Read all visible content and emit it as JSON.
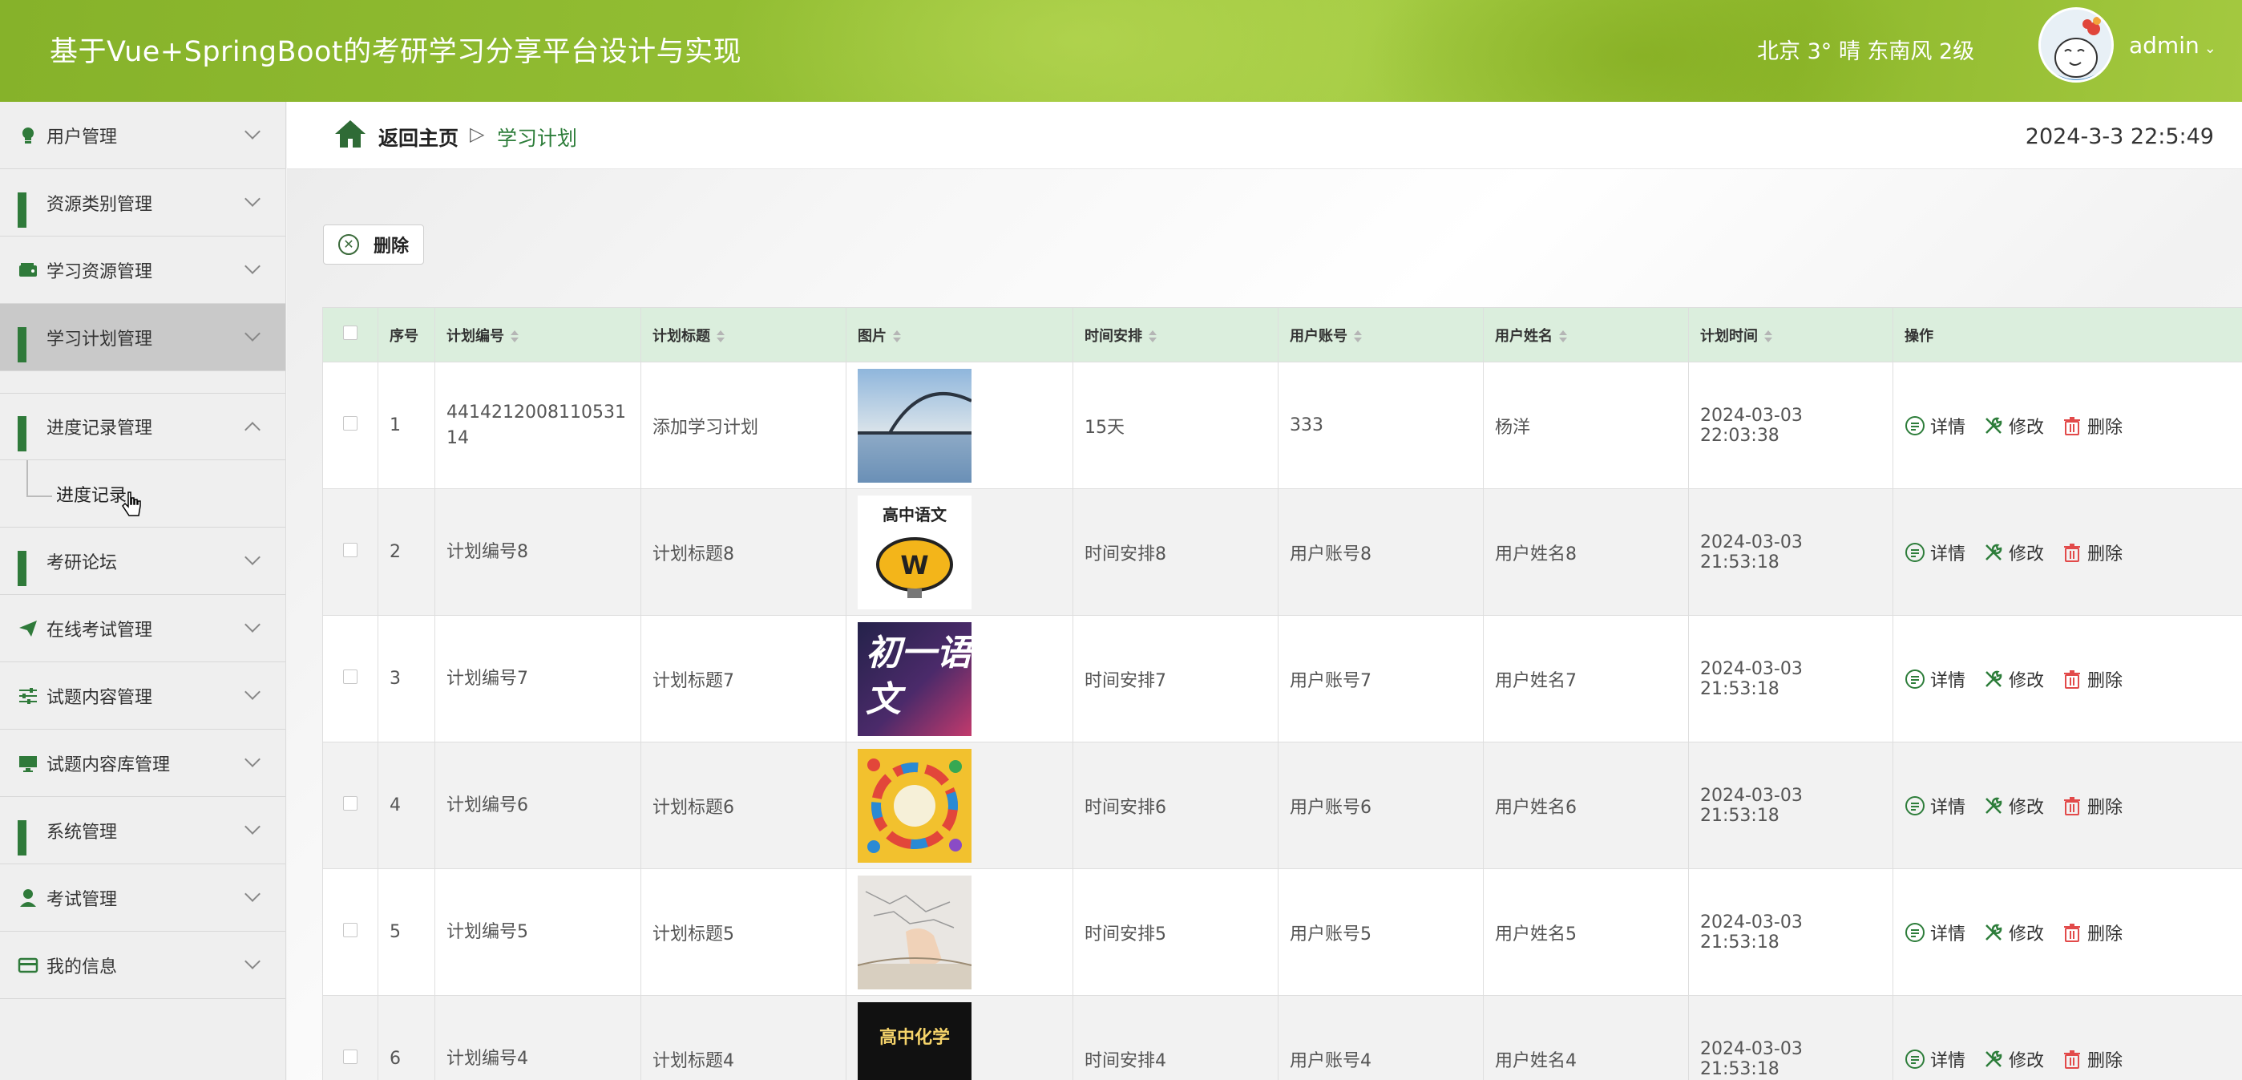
{
  "header": {
    "title": "基于Vue+SpringBoot的考研学习分享平台设计与实现",
    "weather": "北京  3°  晴  东南风  2级",
    "user": "admin"
  },
  "sidebar": {
    "items": [
      {
        "label": "用户管理",
        "icon": "bulb-icon"
      },
      {
        "label": "资源类别管理",
        "icon": "grid-icon"
      },
      {
        "label": "学习资源管理",
        "icon": "wallet-icon"
      },
      {
        "label": "学习计划管理",
        "icon": "grid-icon"
      },
      {
        "label": "进度记录管理",
        "icon": "grid-icon"
      },
      {
        "label": "考研论坛",
        "icon": "grid-icon"
      },
      {
        "label": "在线考试管理",
        "icon": "send-icon"
      },
      {
        "label": "试题内容管理",
        "icon": "sliders-icon"
      },
      {
        "label": "试题内容库管理",
        "icon": "monitor-icon"
      },
      {
        "label": "系统管理",
        "icon": "grid-icon"
      },
      {
        "label": "考试管理",
        "icon": "person-icon"
      },
      {
        "label": "我的信息",
        "icon": "card-icon"
      }
    ],
    "sub_item": "进度记录"
  },
  "breadcrumb": {
    "home": "返回主页",
    "separator": "▷",
    "current": "学习计划"
  },
  "clock": "2024-3-3 22:5:49",
  "toolbar": {
    "delete_label": "删除"
  },
  "table": {
    "headers": [
      "序号",
      "计划编号",
      "计划标题",
      "图片",
      "时间安排",
      "用户账号",
      "用户姓名",
      "计划时间",
      "操作"
    ],
    "actions": {
      "detail": "详情",
      "edit": "修改",
      "delete": "删除"
    },
    "rows": [
      {
        "no": "1",
        "code": "441421200811053114",
        "title": "添加学习计划",
        "image": "bridge-lake-photo",
        "schedule": "15天",
        "account": "333",
        "name": "杨洋",
        "time": "2024-03-03 22:03:38"
      },
      {
        "no": "2",
        "code": "计划编号8",
        "title": "计划标题8",
        "image": "高中语文",
        "schedule": "时间安排8",
        "account": "用户账号8",
        "name": "用户姓名8",
        "time": "2024-03-03 21:53:18"
      },
      {
        "no": "3",
        "code": "计划编号7",
        "title": "计划标题7",
        "image": "初一语文",
        "schedule": "时间安排7",
        "account": "用户账号7",
        "name": "用户姓名7",
        "time": "2024-03-03 21:53:18"
      },
      {
        "no": "4",
        "code": "计划编号6",
        "title": "计划标题6",
        "image": "colorful-wheel-poster",
        "schedule": "时间安排6",
        "account": "用户账号6",
        "name": "用户姓名6",
        "time": "2024-03-03 21:53:18"
      },
      {
        "no": "5",
        "code": "计划编号5",
        "title": "计划标题5",
        "image": "hand-mindmap-photo",
        "schedule": "时间安排5",
        "account": "用户账号5",
        "name": "用户姓名5",
        "time": "2024-03-03 21:53:18"
      },
      {
        "no": "6",
        "code": "计划编号4",
        "title": "计划标题4",
        "image": "高中化学",
        "schedule": "时间安排4",
        "account": "用户账号4",
        "name": "用户姓名4",
        "time": "2024-03-03 21:53:18"
      }
    ]
  },
  "colors": {
    "header_green": "#8fb92d",
    "accent_green": "#2d7d3a",
    "table_head": "#dbeedd"
  }
}
